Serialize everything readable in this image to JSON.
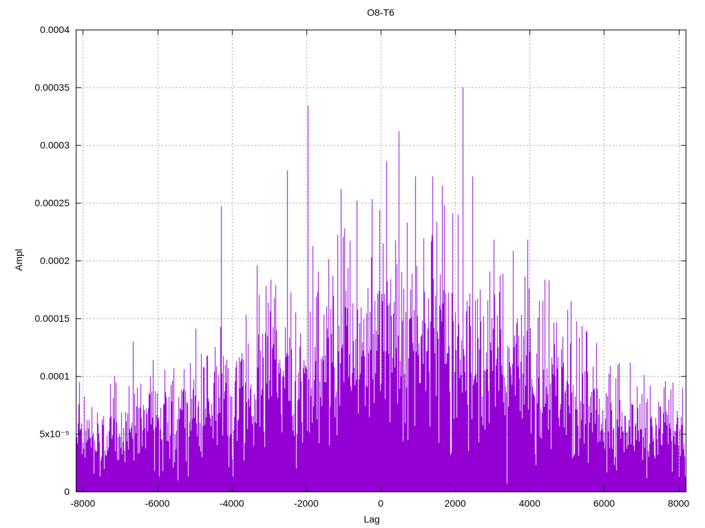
{
  "chart_data": {
    "type": "impulse",
    "title": "O8-T6",
    "xlabel": "Lag",
    "ylabel": "Ampl",
    "xlim": [
      -8192,
      8192
    ],
    "ylim": [
      0,
      0.0004
    ],
    "xticks": [
      {
        "value": -8000,
        "label": "-8000"
      },
      {
        "value": -6000,
        "label": "-6000"
      },
      {
        "value": -4000,
        "label": "-4000"
      },
      {
        "value": -2000,
        "label": "-2000"
      },
      {
        "value": 0,
        "label": "0"
      },
      {
        "value": 2000,
        "label": "2000"
      },
      {
        "value": 4000,
        "label": "4000"
      },
      {
        "value": 6000,
        "label": "6000"
      },
      {
        "value": 8000,
        "label": "8000"
      }
    ],
    "yticks": [
      {
        "value": 0.0,
        "label": "0"
      },
      {
        "value": 5e-05,
        "label": "5x10⁻⁵"
      },
      {
        "value": 0.0001,
        "label": "0.0001"
      },
      {
        "value": 0.00015,
        "label": "0.00015"
      },
      {
        "value": 0.0002,
        "label": "0.0002"
      },
      {
        "value": 0.00025,
        "label": "0.00025"
      },
      {
        "value": 0.0003,
        "label": "0.0003"
      },
      {
        "value": 0.00035,
        "label": "0.00035"
      },
      {
        "value": 0.0004,
        "label": "0.0004"
      }
    ],
    "grid": {
      "show": true,
      "color": "#9c9c9c",
      "style": "dotted"
    },
    "series_color": "#9400d3",
    "background": "#ffffff",
    "border_color": "#000000",
    "n_impulses": 1900,
    "seed": 1337,
    "height_model": {
      "sigma": 0.33,
      "min": 0.02
    },
    "envelope": [
      [
        -8192,
        0.0001
      ],
      [
        -7500,
        9.8e-05
      ],
      [
        -7000,
        0.000105
      ],
      [
        -6500,
        0.000113
      ],
      [
        -6000,
        0.000115
      ],
      [
        -5500,
        0.00013
      ],
      [
        -5000,
        0.00014
      ],
      [
        -4500,
        0.00015
      ],
      [
        -4000,
        0.000157
      ],
      [
        -3500,
        0.00017
      ],
      [
        -3000,
        0.000185
      ],
      [
        -2500,
        0.0002
      ],
      [
        -2000,
        0.000212
      ],
      [
        -1500,
        0.000227
      ],
      [
        -1000,
        0.00024
      ],
      [
        -500,
        0.00025
      ],
      [
        0,
        0.000257
      ],
      [
        400,
        0.000262
      ],
      [
        1000,
        0.000258
      ],
      [
        1500,
        0.000253
      ],
      [
        2000,
        0.000248
      ],
      [
        2500,
        0.00024
      ],
      [
        3000,
        0.000223
      ],
      [
        3500,
        0.000212
      ],
      [
        4000,
        0.000198
      ],
      [
        4500,
        0.000182
      ],
      [
        5000,
        0.000162
      ],
      [
        5500,
        0.000142
      ],
      [
        6000,
        0.000126
      ],
      [
        6500,
        0.000114
      ],
      [
        7000,
        0.000106
      ],
      [
        7500,
        0.0001
      ],
      [
        8192,
        9.5e-05
      ]
    ],
    "notable_peaks": [
      [
        -8100,
        9.5e-05
      ],
      [
        -6660,
        0.00013
      ],
      [
        -4290,
        0.000247
      ],
      [
        -3320,
        0.000196
      ],
      [
        -2514,
        0.000278
      ],
      [
        -1963,
        0.000334
      ],
      [
        -1080,
        0.000262
      ],
      [
        -640,
        0.000252
      ],
      [
        150,
        0.000286
      ],
      [
        477,
        0.000312
      ],
      [
        930,
        0.000273
      ],
      [
        1390,
        0.000273
      ],
      [
        1650,
        0.000265
      ],
      [
        2200,
        0.00035
      ],
      [
        2460,
        0.000273
      ],
      [
        3030,
        0.000218
      ],
      [
        3930,
        0.000218
      ],
      [
        4510,
        0.000183
      ],
      [
        5100,
        0.000165
      ],
      [
        8100,
        9e-05
      ]
    ]
  }
}
